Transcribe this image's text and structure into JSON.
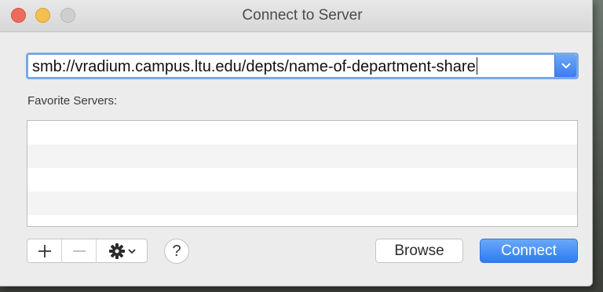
{
  "window": {
    "title": "Connect to Server"
  },
  "server_address": {
    "value": "smb://vradium.campus.ltu.edu/depts/name-of-department-share",
    "dropdown_icon": "chevron-down-icon"
  },
  "favorites": {
    "label": "Favorite Servers:",
    "rows": []
  },
  "toolbar": {
    "add_icon": "plus-icon",
    "remove_icon": "minus-icon",
    "action_icon": "gear-icon",
    "help_label": "?"
  },
  "buttons": {
    "browse": "Browse",
    "connect": "Connect"
  },
  "colors": {
    "accent": "#3b82f6",
    "close": "#ed6a5e",
    "minimize": "#f5bf4f"
  }
}
